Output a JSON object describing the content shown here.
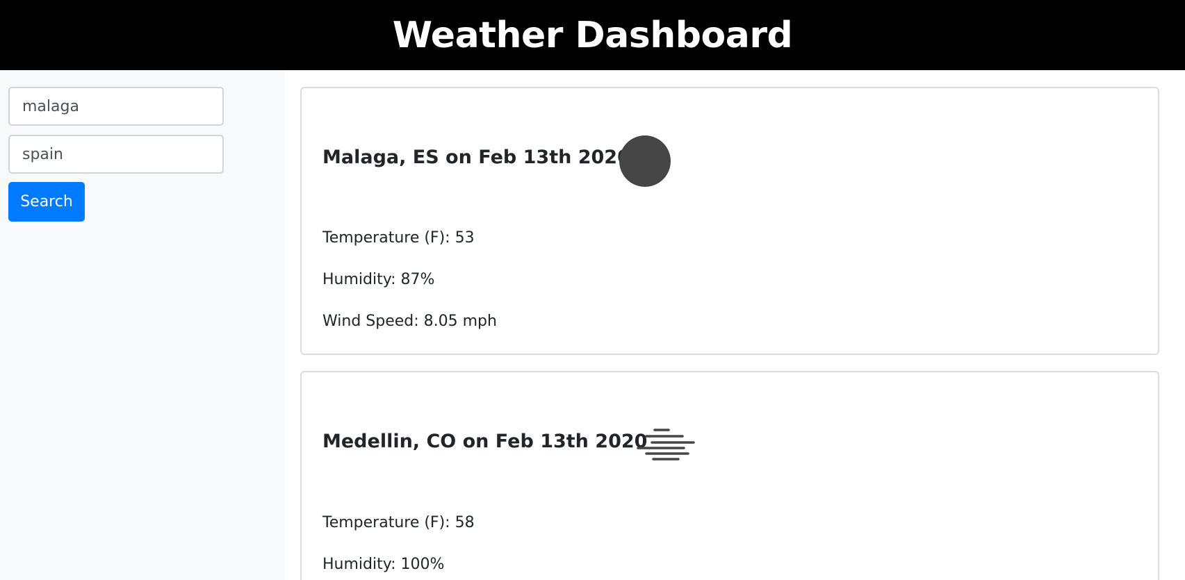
{
  "header": {
    "title": "Weather Dashboard"
  },
  "sidebar": {
    "city_input": {
      "value": "malaga",
      "placeholder": ""
    },
    "country_input": {
      "value": "spain",
      "placeholder": ""
    },
    "search_button": {
      "label": "Search"
    }
  },
  "results": [
    {
      "title": "Malaga, ES on Feb 13th 2020",
      "icon": "clear-sky-circle-icon",
      "temperature": "Temperature (F): 53",
      "humidity": "Humidity: 87%",
      "wind": "Wind Speed: 8.05 mph"
    },
    {
      "title": "Medellin, CO on Feb 13th 2020",
      "icon": "mist-icon",
      "temperature": "Temperature (F): 58",
      "humidity": "Humidity: 100%"
    }
  ],
  "colors": {
    "header_bg": "#000000",
    "sidebar_bg": "#f8f9fa",
    "button_bg": "#007bff",
    "icon_gray": "#454545"
  }
}
